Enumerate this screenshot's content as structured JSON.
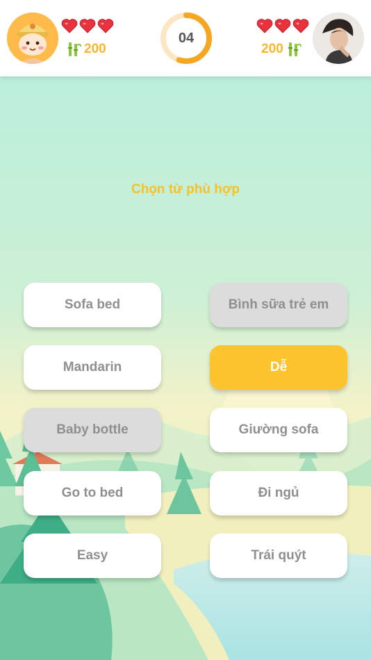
{
  "header": {
    "player_left": {
      "coins": "200",
      "hearts": 3,
      "avatar": "cartoon-boy-hat-avatar"
    },
    "player_right": {
      "coins": "200",
      "hearts": 3,
      "avatar": "photo-avatar"
    },
    "timer": {
      "label": "04",
      "progress": 0.55,
      "ring_color": "#f5a623",
      "track_color": "#fde7c2"
    }
  },
  "prompt": "Chọn từ phù hợp",
  "colors": {
    "accent": "#fcc42e",
    "prompt": "#f7c02c",
    "card_text": "#8f8f8f",
    "heart": "#e8323e",
    "bamboo": "#8cc63f"
  },
  "cards": {
    "left": [
      {
        "label": "Sofa bed",
        "state": "normal"
      },
      {
        "label": "Mandarin",
        "state": "normal"
      },
      {
        "label": "Baby bottle",
        "state": "disabled"
      },
      {
        "label": "Go to bed",
        "state": "normal"
      },
      {
        "label": "Easy",
        "state": "normal"
      }
    ],
    "right": [
      {
        "label": "Bình sữa trẻ em",
        "state": "disabled"
      },
      {
        "label": "Dễ",
        "state": "selected"
      },
      {
        "label": "Giường sofa",
        "state": "normal"
      },
      {
        "label": "Đi ngủ",
        "state": "normal"
      },
      {
        "label": "Trái quýt",
        "state": "normal"
      }
    ]
  }
}
